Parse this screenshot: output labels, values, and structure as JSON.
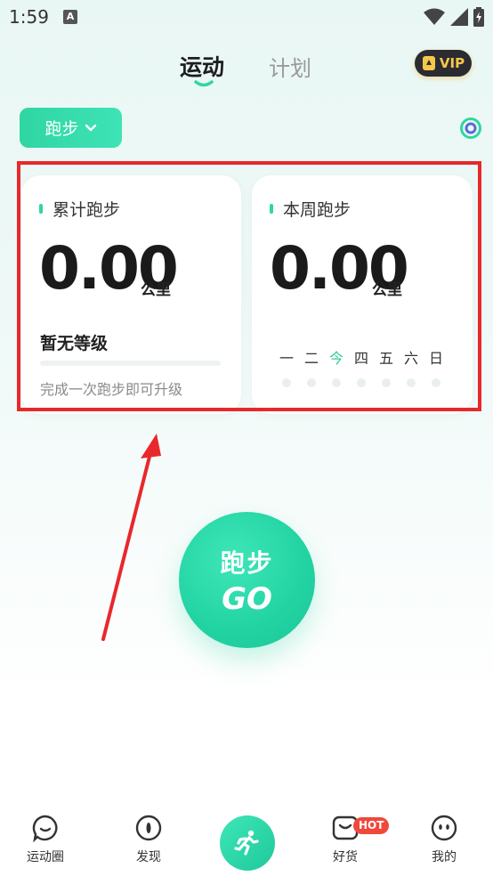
{
  "status_bar": {
    "time": "1:59",
    "notif_letter": "A"
  },
  "top_tabs": {
    "active": "运动",
    "inactive": "计划",
    "vip": "VIP"
  },
  "sport_selector": {
    "label": "跑步"
  },
  "cards": {
    "total": {
      "title": "累计跑步",
      "value": "0.00",
      "unit": "公里",
      "level": "暂无等级",
      "progress": 0,
      "hint": "完成一次跑步即可升级"
    },
    "week": {
      "title": "本周跑步",
      "value": "0.00",
      "unit": "公里",
      "days": [
        "一",
        "二",
        "今",
        "四",
        "五",
        "六",
        "日"
      ],
      "today_index": 2
    }
  },
  "go_button": {
    "line1": "跑步",
    "line2": "GO"
  },
  "bottom_nav": [
    {
      "label": "运动圈",
      "icon": "chat-bubble-icon"
    },
    {
      "label": "发现",
      "icon": "compass-icon"
    },
    {
      "label": "",
      "icon": "runner-icon"
    },
    {
      "label": "好货",
      "icon": "shopping-bag-icon",
      "badge": "HOT"
    },
    {
      "label": "我的",
      "icon": "profile-face-icon"
    }
  ],
  "colors": {
    "accent": "#2fd6a3",
    "annotation": "#e8282a",
    "vip_gold": "#f6c84a",
    "hot": "#f0483b"
  }
}
